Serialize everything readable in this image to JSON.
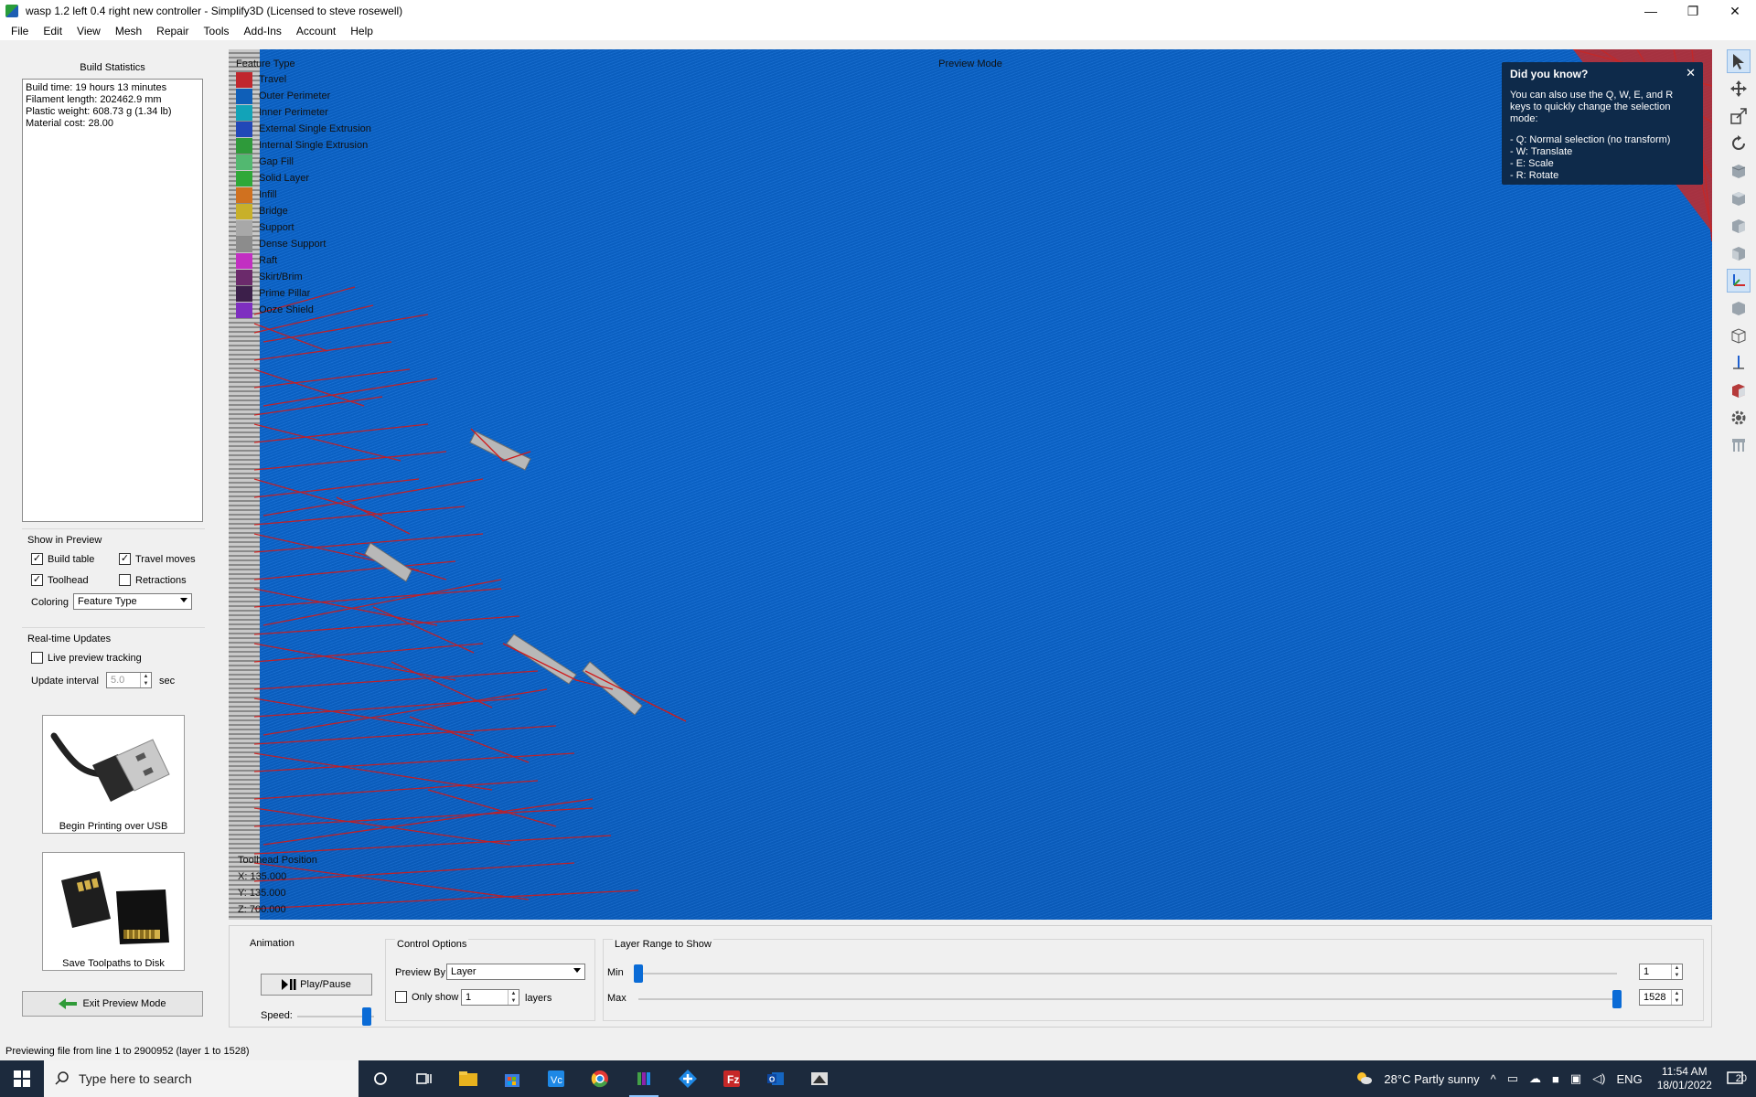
{
  "window": {
    "title": "wasp  1.2 left 0.4 right new controller - Simplify3D (Licensed to steve rosewell)",
    "controls": [
      "—",
      "❐",
      "✕"
    ]
  },
  "menu": [
    "File",
    "Edit",
    "View",
    "Mesh",
    "Repair",
    "Tools",
    "Add-Ins",
    "Account",
    "Help"
  ],
  "build_statistics": {
    "title": "Build Statistics",
    "lines": [
      "Build time: 19 hours 13 minutes",
      "Filament length: 202462.9 mm",
      "Plastic weight: 608.73 g (1.34 lb)",
      "Material cost: 28.00"
    ]
  },
  "show_in_preview": {
    "title": "Show in Preview",
    "build_table": {
      "label": "Build table",
      "checked": true
    },
    "travel_moves": {
      "label": "Travel moves",
      "checked": true
    },
    "toolhead": {
      "label": "Toolhead",
      "checked": true
    },
    "retractions": {
      "label": "Retractions",
      "checked": false
    },
    "coloring_label": "Coloring",
    "coloring_value": "Feature Type"
  },
  "realtime": {
    "title": "Real-time Updates",
    "live_label": "Live preview tracking",
    "live_checked": false,
    "interval_label": "Update interval",
    "interval_value": "5.0",
    "interval_unit": "sec"
  },
  "buttons": {
    "usb": "Begin Printing over USB",
    "disk": "Save Toolpaths to Disk",
    "exit": "Exit Preview Mode"
  },
  "viewport": {
    "mode_label": "Preview Mode",
    "legend_title": "Feature Type",
    "legend": [
      {
        "label": "Travel",
        "color": "#c0272d"
      },
      {
        "label": "Outer Perimeter",
        "color": "#0f5fb8"
      },
      {
        "label": "Inner Perimeter",
        "color": "#12a3b8"
      },
      {
        "label": "External Single Extrusion",
        "color": "#2148b8"
      },
      {
        "label": "Internal Single Extrusion",
        "color": "#2e9a3a"
      },
      {
        "label": "Gap Fill",
        "color": "#52b870"
      },
      {
        "label": "Solid Layer",
        "color": "#2fa838"
      },
      {
        "label": "Infill",
        "color": "#d0711f"
      },
      {
        "label": "Bridge",
        "color": "#c8b02a"
      },
      {
        "label": "Support",
        "color": "#a8a8a8"
      },
      {
        "label": "Dense Support",
        "color": "#8c8c8c"
      },
      {
        "label": "Raft",
        "color": "#c22fc2"
      },
      {
        "label": "Skirt/Brim",
        "color": "#6b2a6b"
      },
      {
        "label": "Prime Pillar",
        "color": "#3c1f4a"
      },
      {
        "label": "Ooze Shield",
        "color": "#7e2fc0"
      }
    ],
    "toolhead_title": "Toolhead Position",
    "toolhead_x": "X: 135.000",
    "toolhead_y": "Y: 135.000",
    "toolhead_z": "Z: 700.000"
  },
  "tip": {
    "title": "Did you know?",
    "close": "✕",
    "body": "You can also use the Q, W, E, and R keys to quickly change the selection mode:",
    "items": [
      "- Q: Normal selection (no transform)",
      "- W: Translate",
      "- E: Scale",
      "- R: Rotate"
    ]
  },
  "animation": {
    "title": "Animation",
    "play_label": "Play/Pause",
    "speed_label": "Speed:",
    "speed_level": 0.9
  },
  "control_options": {
    "title": "Control Options",
    "preview_by_label": "Preview By",
    "preview_by_value": "Layer",
    "only_show_label": "Only show",
    "only_show_value": "1",
    "layers_label": "layers"
  },
  "layer_range": {
    "title": "Layer Range to Show",
    "min_label": "Min",
    "max_label": "Max",
    "min_value": "1",
    "max_value": "1528",
    "total_layers": 1528
  },
  "status": "Previewing file from line 1 to 2900952 (layer 1 to 1528)",
  "taskbar": {
    "search_placeholder": "Type here to search",
    "weather": "28°C  Partly sunny",
    "lang": "ENG",
    "time": "11:54 AM",
    "date": "18/01/2022",
    "notifications": "20"
  }
}
